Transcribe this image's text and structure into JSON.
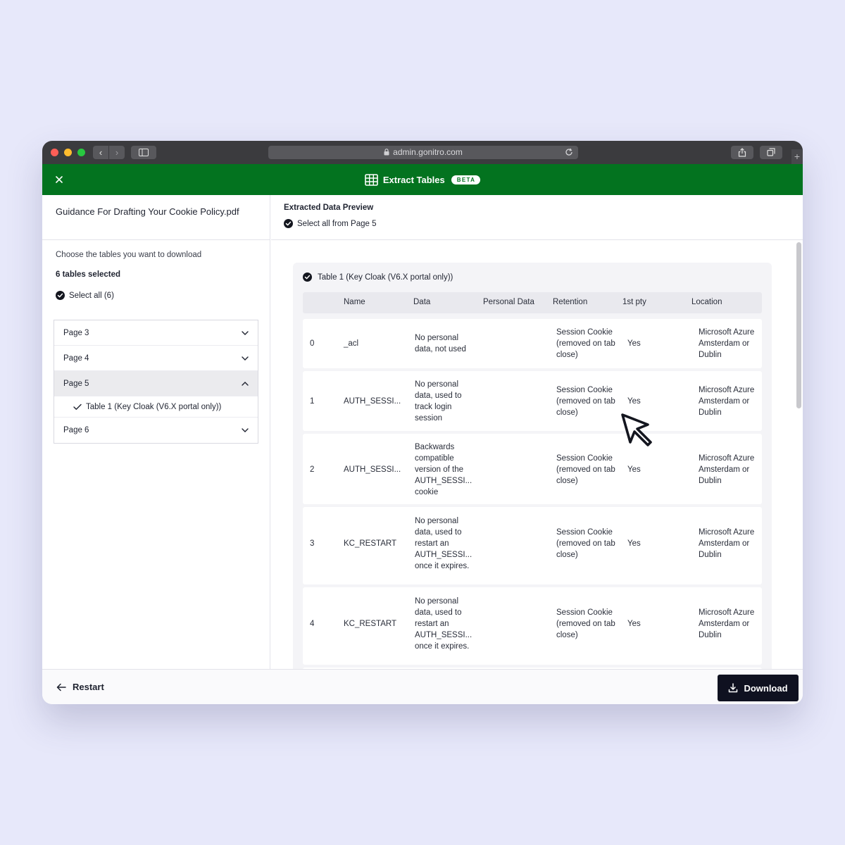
{
  "browser": {
    "url": "admin.gonitro.com"
  },
  "app": {
    "title": "Extract Tables",
    "badge": "BETA"
  },
  "sidebar": {
    "document_name": "Guidance For Drafting Your Cookie Policy.pdf",
    "instruction": "Choose the tables you want to download",
    "selected_count": "6 tables selected",
    "select_all_label": "Select all (6)",
    "pages": [
      {
        "label": "Page 3",
        "expanded": false
      },
      {
        "label": "Page 4",
        "expanded": false
      },
      {
        "label": "Page 5",
        "expanded": true,
        "tables": [
          "Table 1 (Key Cloak (V6.X portal only))"
        ]
      },
      {
        "label": "Page 6",
        "expanded": false
      }
    ]
  },
  "preview": {
    "heading": "Extracted Data Preview",
    "select_page_label": "Select all from Page 5",
    "table_title": "Table 1 (Key Cloak (V6.X portal only))",
    "columns": [
      "Name",
      "Data",
      "Personal Data",
      "Retention",
      "1st pty",
      "Location"
    ],
    "rows": [
      {
        "idx": "0",
        "name": "_acl",
        "data": "No personal data, not used",
        "personal": "",
        "retention": "Session Cookie (removed on tab close)",
        "pty": "Yes",
        "location": "Microsoft Azure Amsterdam or Dublin"
      },
      {
        "idx": "1",
        "name": "AUTH_SESSI...",
        "data": "No personal data, used to track login session",
        "personal": "",
        "retention": "Session Cookie (removed on tab close)",
        "pty": "Yes",
        "location": "Microsoft Azure Amsterdam or Dublin"
      },
      {
        "idx": "2",
        "name": "AUTH_SESSI...",
        "data": "Backwards compatible version of the AUTH_SESSI... cookie",
        "personal": "",
        "retention": "Session Cookie (removed on tab close)",
        "pty": "Yes",
        "location": "Microsoft Azure Amsterdam or Dublin"
      },
      {
        "idx": "3",
        "name": "KC_RESTART",
        "data": "No personal data, used to restart an AUTH_SESSI... once it expires.",
        "personal": "",
        "retention": "Session Cookie (removed on tab close)",
        "pty": "Yes",
        "location": "Microsoft Azure Amsterdam or Dublin"
      },
      {
        "idx": "4",
        "name": "KC_RESTART",
        "data": "No personal data, used to restart an AUTH_SESSI... once it expires.",
        "personal": "",
        "retention": "Session Cookie (removed on tab close)",
        "pty": "Yes",
        "location": "Microsoft Azure Amsterdam or Dublin"
      }
    ]
  },
  "footer": {
    "restart_label": "Restart",
    "download_label": "Download"
  },
  "colors": {
    "header_green": "#03731f",
    "primary_dark": "#0f1120",
    "background": "#e7e8fa"
  }
}
